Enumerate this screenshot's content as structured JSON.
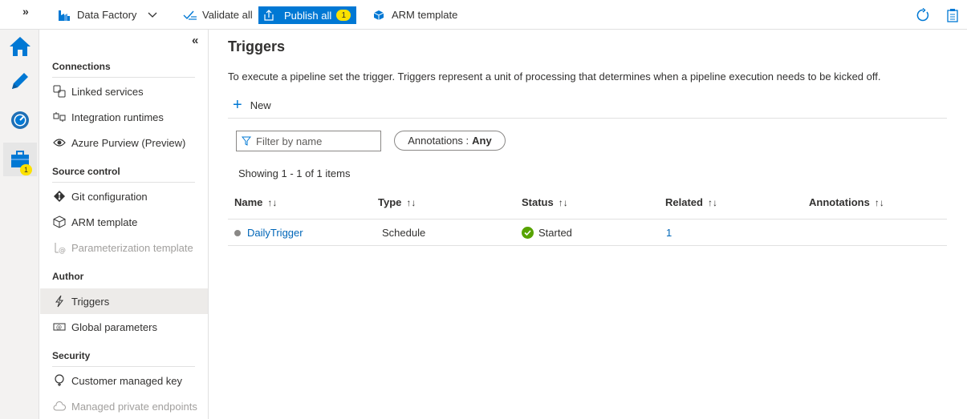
{
  "topbar": {
    "factory_label": "Data Factory",
    "validate_label": "Validate all",
    "publish_label": "Publish all",
    "publish_count": "1",
    "arm_label": "ARM template"
  },
  "rail": {
    "manage_badge": "1"
  },
  "sidenav": {
    "sections": {
      "connections": "Connections",
      "source_control": "Source control",
      "author": "Author",
      "security": "Security"
    },
    "items": {
      "linked_services": "Linked services",
      "integration_runtimes": "Integration runtimes",
      "azure_purview": "Azure Purview (Preview)",
      "git_configuration": "Git configuration",
      "arm_template": "ARM template",
      "parameterization_template": "Parameterization template",
      "triggers": "Triggers",
      "global_parameters": "Global parameters",
      "customer_managed_key": "Customer managed key",
      "managed_private_endpoints": "Managed private endpoints"
    }
  },
  "main": {
    "title": "Triggers",
    "description": "To execute a pipeline set the trigger. Triggers represent a unit of processing that determines when a pipeline execution needs to be kicked off.",
    "new_label": "New",
    "filter_placeholder": "Filter by name",
    "annotations_label": "Annotations :",
    "annotations_value": "Any",
    "showing": "Showing 1 - 1 of 1 items",
    "columns": {
      "name": "Name",
      "type": "Type",
      "status": "Status",
      "related": "Related",
      "annotations": "Annotations"
    },
    "rows": [
      {
        "name": "DailyTrigger",
        "type": "Schedule",
        "status": "Started",
        "related": "1"
      }
    ]
  },
  "colors": {
    "accent": "#0078d4",
    "badge": "#fce100",
    "success": "#57a300"
  }
}
